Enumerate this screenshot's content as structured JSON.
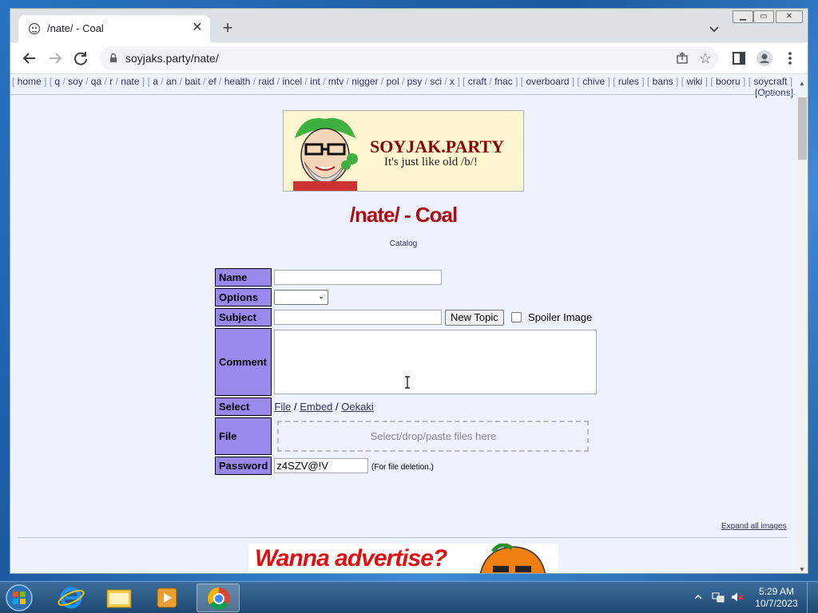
{
  "browser": {
    "tab_title": "/nate/ - Coal",
    "url": "soyjaks.party/nate/"
  },
  "boardlist": {
    "groups": [
      [
        "home"
      ],
      [
        "q",
        "soy",
        "qa",
        "r",
        "nate"
      ],
      [
        "a",
        "an",
        "bait",
        "ef",
        "health",
        "raid",
        "incel",
        "int",
        "mtv",
        "nigger",
        "pol",
        "psy",
        "sci",
        "x"
      ],
      [
        "craft",
        "fnac"
      ],
      [
        "overboard"
      ],
      [
        "chive"
      ],
      [
        "rules"
      ],
      [
        "bans"
      ],
      [
        "wiki"
      ],
      [
        "booru"
      ],
      [
        "soycraft"
      ]
    ],
    "options_label": "[Options]"
  },
  "banner": {
    "title": "SOYJAK.PARTY",
    "subtitle": "It's just like old /b/!"
  },
  "board": {
    "title": "/nate/ - Coal",
    "catalog_link": "Catalog"
  },
  "form": {
    "name_label": "Name",
    "options_label": "Options",
    "subject_label": "Subject",
    "new_topic_button": "New Topic",
    "spoiler_label": "Spoiler Image",
    "comment_label": "Comment",
    "select_label": "Select",
    "select_links": [
      "File",
      "Embed",
      "Oekaki"
    ],
    "file_label": "File",
    "dropzone_text": "Select/drop/paste files here",
    "password_label": "Password",
    "password_value": "z4SZV@!V",
    "password_note": "(For file deletion.)"
  },
  "page": {
    "expand_images": "Expand all images",
    "ad_text": "Wanna advertise?"
  },
  "taskbar": {
    "time": "5:29 AM",
    "date": "10/7/2023"
  },
  "colors": {
    "header_cell": "#9988ee",
    "board_title": "#af0a0f",
    "page_bg": "#eef2ff"
  }
}
